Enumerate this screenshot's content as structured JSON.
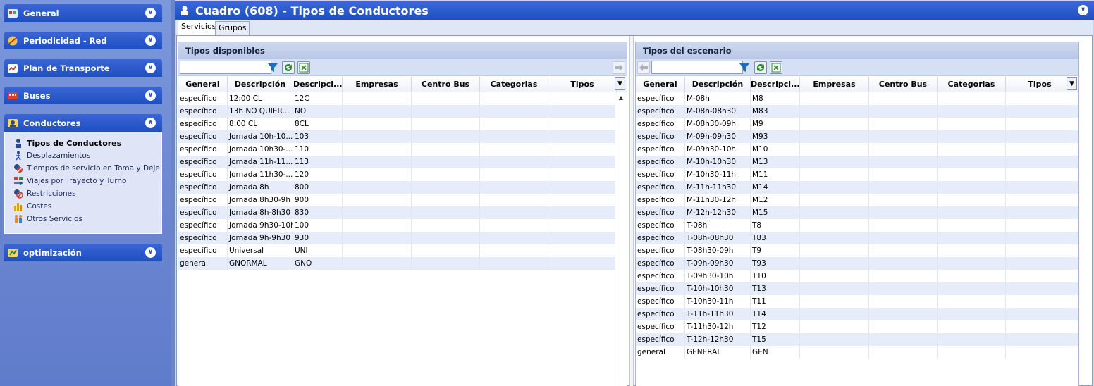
{
  "sidebar": {
    "sections": [
      {
        "label": "General",
        "icon": "general-icon"
      },
      {
        "label": "Periodicidad - Red",
        "icon": "periodicidad-icon"
      },
      {
        "label": "Plan de Transporte",
        "icon": "plan-transporte-icon"
      },
      {
        "label": "Buses",
        "icon": "bus-icon"
      },
      {
        "label": "Conductores",
        "icon": "conductores-icon"
      },
      {
        "label": "optimización",
        "icon": "optimizacion-icon"
      }
    ],
    "items": [
      {
        "label": "Tipos de Conductores",
        "icon": "driver-icon"
      },
      {
        "label": "Desplazamientos",
        "icon": "walker-icon"
      },
      {
        "label": "Tiempos de servicio en Toma y Deje",
        "icon": "service-time-icon"
      },
      {
        "label": "Viajes por Trayecto y Turno",
        "icon": "trips-icon"
      },
      {
        "label": "Restricciones",
        "icon": "restrictions-icon"
      },
      {
        "label": "Costes",
        "icon": "costs-icon"
      },
      {
        "label": "Otros Servicios",
        "icon": "other-services-icon"
      }
    ]
  },
  "header": {
    "title": "Cuadro (608) - Tipos de Conductores"
  },
  "tabs": [
    "Servicios",
    "Grupos"
  ],
  "columns": [
    "General",
    "Descripción",
    "Descripci...",
    "Empresas",
    "Centro Bus",
    "Categorias",
    "Tipos"
  ],
  "left_panel": {
    "title": "Tipos disponibles",
    "rows": [
      [
        "específico",
        "12:00 CL",
        "12C"
      ],
      [
        "específico",
        "13h NO QUIER...",
        "NO"
      ],
      [
        "específico",
        "8:00 CL",
        "8CL"
      ],
      [
        "específico",
        "Jornada 10h-10...",
        "103"
      ],
      [
        "específico",
        "Jornada 10h30-...",
        "110"
      ],
      [
        "específico",
        "Jornada 11h-11...",
        "113"
      ],
      [
        "específico",
        "Jornada 11h30-...",
        "120"
      ],
      [
        "específico",
        "Jornada 8h",
        "800"
      ],
      [
        "específico",
        "Jornada 8h30-9h",
        "900"
      ],
      [
        "específico",
        "Jornada 8h-8h30",
        "830"
      ],
      [
        "específico",
        "Jornada 9h30-10h",
        "100"
      ],
      [
        "específico",
        "Jornada 9h-9h30",
        "930"
      ],
      [
        "específico",
        "Universal",
        "UNI"
      ],
      [
        "general",
        "GNORMAL",
        "GNO"
      ]
    ]
  },
  "right_panel": {
    "title": "Tipos del escenario",
    "rows": [
      [
        "específico",
        "M-08h",
        "M8"
      ],
      [
        "específico",
        "M-08h-08h30",
        "M83"
      ],
      [
        "específico",
        "M-08h30-09h",
        "M9"
      ],
      [
        "específico",
        "M-09h-09h30",
        "M93"
      ],
      [
        "específico",
        "M-09h30-10h",
        "M10"
      ],
      [
        "específico",
        "M-10h-10h30",
        "M13"
      ],
      [
        "específico",
        "M-10h30-11h",
        "M11"
      ],
      [
        "específico",
        "M-11h-11h30",
        "M14"
      ],
      [
        "específico",
        "M-11h30-12h",
        "M12"
      ],
      [
        "específico",
        "M-12h-12h30",
        "M15"
      ],
      [
        "específico",
        "T-08h",
        "T8"
      ],
      [
        "específico",
        "T-08h-08h30",
        "T83"
      ],
      [
        "específico",
        "T-08h30-09h",
        "T9"
      ],
      [
        "específico",
        "T-09h-09h30",
        "T93"
      ],
      [
        "específico",
        "T-09h30-10h",
        "T10"
      ],
      [
        "específico",
        "T-10h-10h30",
        "T13"
      ],
      [
        "específico",
        "T-10h30-11h",
        "T11"
      ],
      [
        "específico",
        "T-11h-11h30",
        "T14"
      ],
      [
        "específico",
        "T-11h30-12h",
        "T12"
      ],
      [
        "específico",
        "T-12h-12h30",
        "T15"
      ],
      [
        "general",
        "GENERAL",
        "GEN"
      ]
    ]
  },
  "colors": {
    "header_blue": "#1f4fc0",
    "row_alt": "#e6ecf9",
    "sidebar_bg": "#6b86c8"
  }
}
